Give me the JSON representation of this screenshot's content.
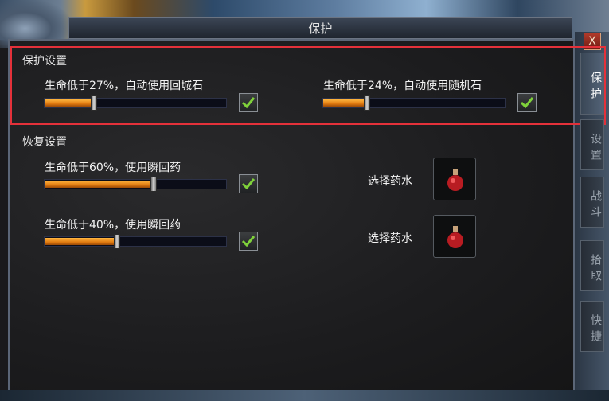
{
  "window": {
    "title": "保护",
    "close_label": "X"
  },
  "protect_settings": {
    "heading": "保护设置",
    "items": [
      {
        "label": "生命低于27%，自动使用回城石",
        "value_percent": 27,
        "checked": true
      },
      {
        "label": "生命低于24%，自动使用随机石",
        "value_percent": 24,
        "checked": true
      }
    ]
  },
  "recovery_settings": {
    "heading": "恢复设置",
    "items": [
      {
        "label": "生命低于60%，使用瞬回药",
        "value_percent": 60,
        "checked": true,
        "potion_label": "选择药水",
        "potion_icon": "red-potion-icon"
      },
      {
        "label": "生命低于40%，使用瞬回药",
        "value_percent": 40,
        "checked": true,
        "potion_label": "选择药水",
        "potion_icon": "red-potion-icon"
      }
    ]
  },
  "tabs": [
    {
      "label": "保护",
      "active": true
    },
    {
      "label": "设置",
      "active": false
    },
    {
      "label": "战斗",
      "active": false
    },
    {
      "label": "拾取",
      "active": false
    },
    {
      "label": "快捷",
      "active": false
    }
  ],
  "colors": {
    "accent": "#f59a1e",
    "highlight_border": "#e4313a",
    "check": "#7fd13a"
  }
}
